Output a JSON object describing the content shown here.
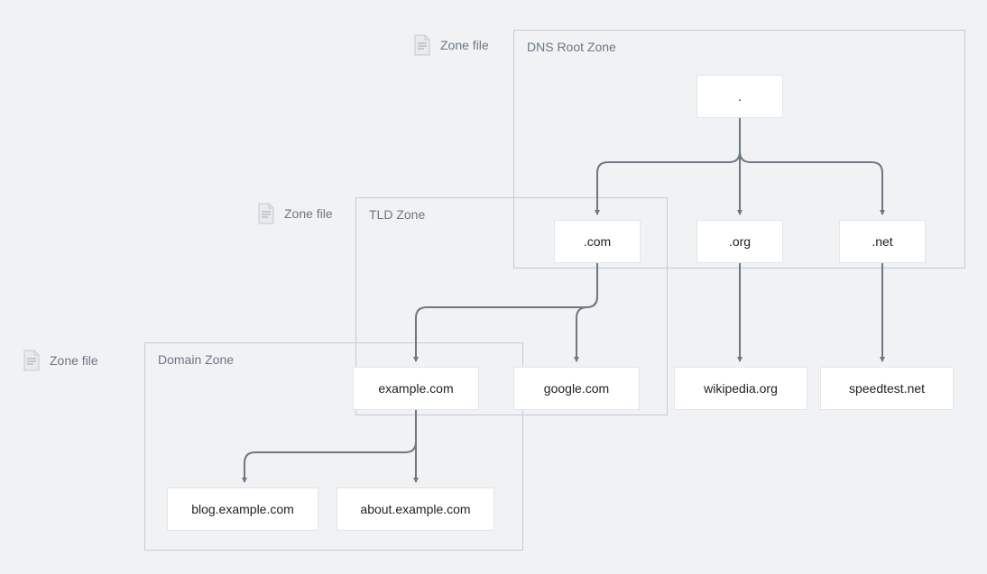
{
  "labels": {
    "zone_file": "Zone file"
  },
  "zones": {
    "root": {
      "title": "DNS Root Zone"
    },
    "tld": {
      "title": "TLD Zone"
    },
    "domain": {
      "title": "Domain Zone"
    }
  },
  "nodes": {
    "root": ".",
    "com": ".com",
    "org": ".org",
    "net": ".net",
    "example_com": "example.com",
    "google_com": "google.com",
    "wikipedia_org": "wikipedia.org",
    "speedtest_net": "speedtest.net",
    "blog_example": "blog.example.com",
    "about_example": "about.example.com"
  },
  "colors": {
    "arrow": "#6d7882"
  }
}
